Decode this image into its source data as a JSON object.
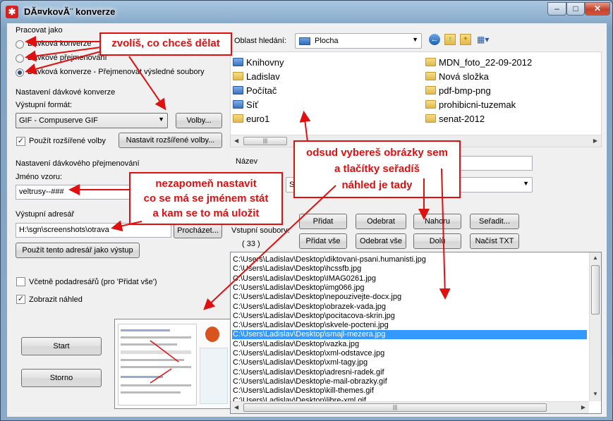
{
  "window": {
    "title": "DĂ¤vkovĂ¨ konverze",
    "controls": {
      "minimize": "–",
      "maximize": "□",
      "close": "✕"
    },
    "icon": "app-logo-icon"
  },
  "mode": {
    "group_title": "Pracovat jako",
    "options": [
      "Dávková konverze",
      "Dávkové přejmenování",
      "Dávková konverze - Přejmenovat výsledné soubory"
    ],
    "selected_index": 2
  },
  "conversion": {
    "group_title": "Nastavení dávkové konverze",
    "format_label": "Výstupní formát:",
    "format_value": "GIF - Compuserve GIF",
    "options_button": "Volby...",
    "advanced_checkbox": "Použít rozšířené volby",
    "advanced_checked": true,
    "advanced_button": "Nastavit rozšířené volby..."
  },
  "rename": {
    "group_title": "Nastavení dávkového přejmenování",
    "pattern_label": "Jméno vzoru:",
    "pattern_value": "veltrusy--###"
  },
  "output": {
    "dir_label": "Výstupní adresář",
    "dir_value": "H:\\sgn\\screenshots\\otrava",
    "browse_button": "Procházet...",
    "use_dir_button": "Použít tento adresář jako výstup"
  },
  "options": {
    "subdirs_label": "Včetně podadresářů (pro 'Přidat vše')",
    "subdirs_checked": false,
    "preview_label": "Zobrazit náhled",
    "preview_checked": true
  },
  "actions": {
    "start": "Start",
    "cancel": "Storno"
  },
  "browser": {
    "lookin_label": "Oblast hledání:",
    "lookin_value": "Plocha",
    "items_left": [
      "Knihovny",
      "Ladislav",
      "Počítač",
      "Síť",
      "euro1"
    ],
    "items_right": [
      "MDN_foto_22-09-2012",
      "Nová složka",
      "pdf-bmp-png",
      "prohibicni-tuzemak",
      "senat-2012"
    ],
    "name_label": "Název",
    "type_value": "S"
  },
  "file_buttons": {
    "add": "Přidat",
    "remove": "Odebrat",
    "up": "Nahoru",
    "sort": "Seřadit...",
    "add_all": "Přidat vše",
    "remove_all": "Odebrat vše",
    "down": "Dolů",
    "load_txt": "Načíst TXT"
  },
  "source": {
    "label": "Vstupní soubory:",
    "count": "( 33 )",
    "files": [
      "C:\\Users\\Ladislav\\Desktop\\diktovani-psani.humanisti.jpg",
      "C:\\Users\\Ladislav\\Desktop\\hcssfb.jpg",
      "C:\\Users\\Ladislav\\Desktop\\IMAG0261.jpg",
      "C:\\Users\\Ladislav\\Desktop\\img066.jpg",
      "C:\\Users\\Ladislav\\Desktop\\nepouzivejte-docx.jpg",
      "C:\\Users\\Ladislav\\Desktop\\obrazek-vada.jpg",
      "C:\\Users\\Ladislav\\Desktop\\pocitacova-skrin.jpg",
      "C:\\Users\\Ladislav\\Desktop\\skvele-pocteni.jpg",
      "C:\\Users\\Ladislav\\Desktop\\smajl-mezera.jpg",
      "C:\\Users\\Ladislav\\Desktop\\vazka.jpg",
      "C:\\Users\\Ladislav\\Desktop\\xml-odstavce.jpg",
      "C:\\Users\\Ladislav\\Desktop\\xml-tagy.jpg",
      "C:\\Users\\Ladislav\\Desktop\\adresni-radek.gif",
      "C:\\Users\\Ladislav\\Desktop\\e-mail-obrazky.gif",
      "C:\\Users\\Ladislav\\Desktop\\kill-themes.gif",
      "C:\\Users\\Ladislav\\Desktop\\libre-xml.gif"
    ],
    "selected_index": 8
  },
  "annotations": {
    "choose": "zvolíš, co chceš dělat",
    "remember_1": "nezapomeň nastavit",
    "remember_2": "co se má se jménem stát",
    "remember_3": "a kam se to má uložit",
    "select_1": "odsud vybereš obrázky sem",
    "select_2": "a tlačítky seřadíš",
    "select_3": "náhled je tady",
    "color": "#e01010"
  }
}
